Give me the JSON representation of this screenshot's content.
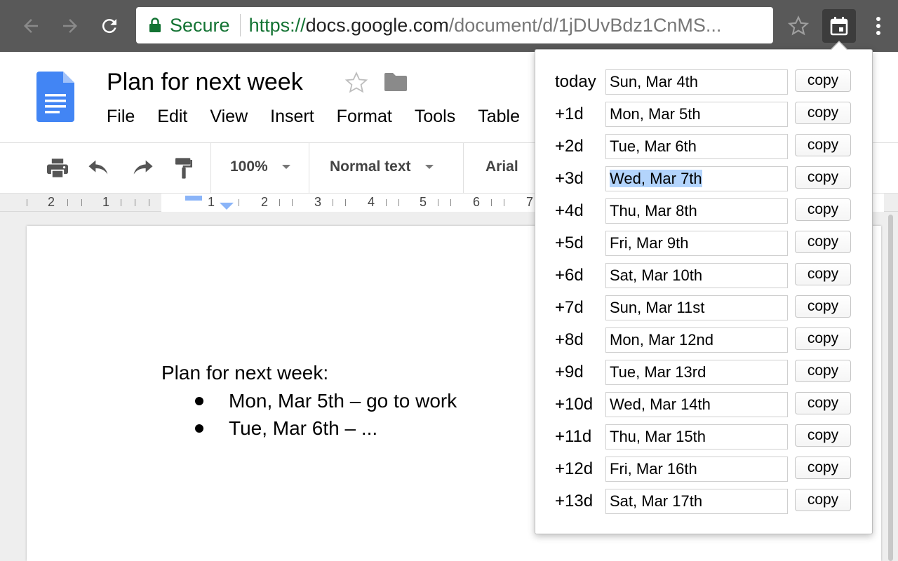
{
  "browser": {
    "secure_label": "Secure",
    "url_scheme": "https://",
    "url_host": "docs.google.com",
    "url_path": "/document/d/1jDUvBdz1CnMS...",
    "secure_color": "#137333"
  },
  "doc": {
    "title": "Plan for next week",
    "menus": [
      "File",
      "Edit",
      "View",
      "Insert",
      "Format",
      "Tools",
      "Table"
    ],
    "toolbar": {
      "zoom": "100%",
      "style": "Normal text",
      "font": "Arial"
    },
    "ruler_numbers": [
      "2",
      "1",
      "1",
      "2",
      "3",
      "4",
      "5",
      "6",
      "7"
    ],
    "body": {
      "heading": "Plan for next week:",
      "bullets": [
        "Mon, Mar 5th – go to work",
        "Tue, Mar 6th – ..."
      ]
    }
  },
  "popup": {
    "copy_label": "copy",
    "selected_index": 3,
    "selection_color": "#b3d4fc",
    "rows": [
      {
        "label": "today",
        "value": "Sun, Mar 4th"
      },
      {
        "label": "+1d",
        "value": "Mon, Mar 5th"
      },
      {
        "label": "+2d",
        "value": "Tue, Mar 6th"
      },
      {
        "label": "+3d",
        "value": "Wed, Mar 7th"
      },
      {
        "label": "+4d",
        "value": "Thu, Mar 8th"
      },
      {
        "label": "+5d",
        "value": "Fri, Mar 9th"
      },
      {
        "label": "+6d",
        "value": "Sat, Mar 10th"
      },
      {
        "label": "+7d",
        "value": "Sun, Mar 11st"
      },
      {
        "label": "+8d",
        "value": "Mon, Mar 12nd"
      },
      {
        "label": "+9d",
        "value": "Tue, Mar 13rd"
      },
      {
        "label": "+10d",
        "value": "Wed, Mar 14th"
      },
      {
        "label": "+11d",
        "value": "Thu, Mar 15th"
      },
      {
        "label": "+12d",
        "value": "Fri, Mar 16th"
      },
      {
        "label": "+13d",
        "value": "Sat, Mar 17th"
      }
    ]
  }
}
